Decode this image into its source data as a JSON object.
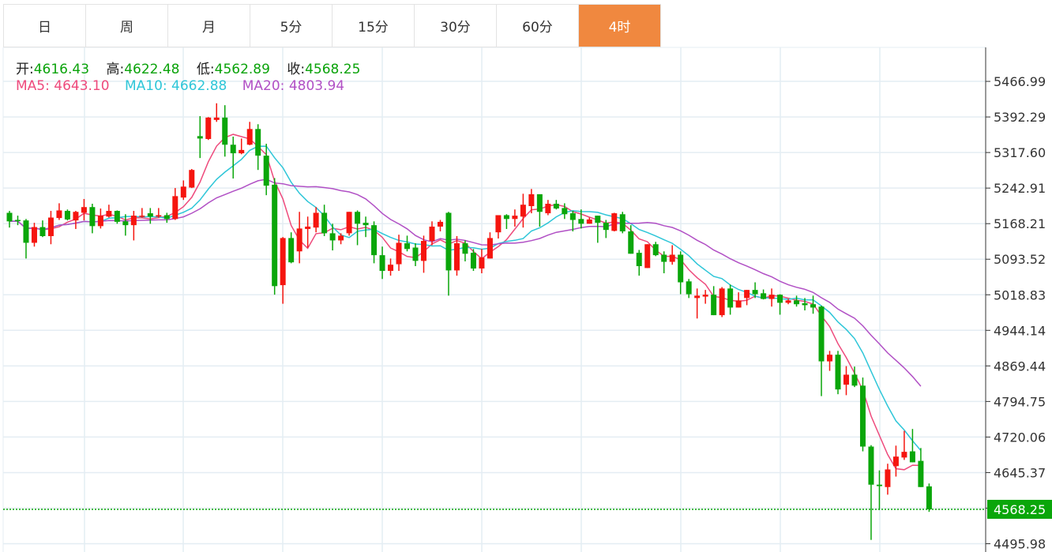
{
  "tabs": [
    {
      "label": "日",
      "active": false
    },
    {
      "label": "周",
      "active": false
    },
    {
      "label": "月",
      "active": false
    },
    {
      "label": "5分",
      "active": false
    },
    {
      "label": "15分",
      "active": false
    },
    {
      "label": "30分",
      "active": false
    },
    {
      "label": "60分",
      "active": false
    },
    {
      "label": "4时",
      "active": true
    }
  ],
  "info": {
    "open_label": "开:",
    "open": "4616.43",
    "high_label": "高:",
    "high": "4622.48",
    "low_label": "低:",
    "low": "4562.89",
    "close_label": "收:",
    "close": "4568.25",
    "ma5_label": "MA5:",
    "ma5": "4643.10",
    "ma10_label": "MA10:",
    "ma10": "4662.88",
    "ma20_label": "MA20:",
    "ma20": "4803.94"
  },
  "colors": {
    "up": "#f5150f",
    "down": "#0aa60a",
    "ma5": "#ee4a7c",
    "ma10": "#2ec6d8",
    "ma20": "#b150c5",
    "accent": "#f0883f",
    "grid": "#e4edf3"
  },
  "chart_data": {
    "type": "candlestick",
    "y_ticks": [
      "5466.99",
      "5392.29",
      "5317.60",
      "5242.91",
      "5168.21",
      "5093.52",
      "5018.83",
      "4944.14",
      "4869.44",
      "4794.75",
      "4720.06",
      "4645.37",
      "4570.68",
      "4495.98"
    ],
    "ylim": [
      4478.6,
      5538.4
    ],
    "last_price": "4568.25",
    "grid": true,
    "ohlc": [
      [
        5191,
        5195,
        5160,
        5173
      ],
      [
        5176,
        5185,
        5165,
        5174
      ],
      [
        5175,
        5178,
        5095,
        5128
      ],
      [
        5128,
        5170,
        5120,
        5161
      ],
      [
        5161,
        5175,
        5140,
        5142
      ],
      [
        5142,
        5195,
        5125,
        5181
      ],
      [
        5180,
        5211,
        5176,
        5196
      ],
      [
        5195,
        5198,
        5175,
        5177
      ],
      [
        5175,
        5195,
        5157,
        5193
      ],
      [
        5191,
        5220,
        5175,
        5203
      ],
      [
        5203,
        5210,
        5148,
        5163
      ],
      [
        5163,
        5200,
        5158,
        5185
      ],
      [
        5183,
        5208,
        5181,
        5195
      ],
      [
        5195,
        5196,
        5168,
        5172
      ],
      [
        5173,
        5188,
        5143,
        5165
      ],
      [
        5165,
        5195,
        5133,
        5185
      ],
      [
        5183,
        5201,
        5181,
        5185
      ],
      [
        5190,
        5201,
        5168,
        5183
      ],
      [
        5183,
        5201,
        5181,
        5186
      ],
      [
        5186,
        5191,
        5170,
        5178
      ],
      [
        5178,
        5243,
        5176,
        5226
      ],
      [
        5223,
        5259,
        5218,
        5246
      ],
      [
        5244,
        5283,
        5243,
        5281
      ],
      [
        5352,
        5394,
        5306,
        5347
      ],
      [
        5346,
        5392,
        5344,
        5391
      ],
      [
        5386,
        5421,
        5382,
        5391
      ],
      [
        5391,
        5417,
        5309,
        5334
      ],
      [
        5334,
        5351,
        5263,
        5316
      ],
      [
        5316,
        5347,
        5314,
        5323
      ],
      [
        5334,
        5382,
        5333,
        5367
      ],
      [
        5367,
        5377,
        5281,
        5311
      ],
      [
        5311,
        5336,
        5228,
        5248
      ],
      [
        5250,
        5264,
        5019,
        5037
      ],
      [
        5039,
        5140,
        5000,
        5138
      ],
      [
        5138,
        5150,
        5085,
        5087
      ],
      [
        5110,
        5193,
        5085,
        5158
      ],
      [
        5157,
        5183,
        5118,
        5162
      ],
      [
        5160,
        5203,
        5150,
        5191
      ],
      [
        5191,
        5208,
        5142,
        5148
      ],
      [
        5148,
        5168,
        5112,
        5133
      ],
      [
        5133,
        5148,
        5125,
        5143
      ],
      [
        5148,
        5193,
        5143,
        5193
      ],
      [
        5193,
        5196,
        5123,
        5168
      ],
      [
        5170,
        5183,
        5140,
        5165
      ],
      [
        5165,
        5173,
        5085,
        5102
      ],
      [
        5102,
        5120,
        5052,
        5069
      ],
      [
        5069,
        5095,
        5059,
        5082
      ],
      [
        5083,
        5145,
        5069,
        5128
      ],
      [
        5127,
        5143,
        5110,
        5115
      ],
      [
        5118,
        5127,
        5079,
        5090
      ],
      [
        5090,
        5143,
        5065,
        5132
      ],
      [
        5132,
        5173,
        5123,
        5162
      ],
      [
        5162,
        5176,
        5152,
        5172
      ],
      [
        5191,
        5193,
        5017,
        5070
      ],
      [
        5070,
        5142,
        5059,
        5127
      ],
      [
        5127,
        5133,
        5089,
        5105
      ],
      [
        5107,
        5115,
        5069,
        5074
      ],
      [
        5074,
        5115,
        5064,
        5097
      ],
      [
        5095,
        5150,
        5095,
        5138
      ],
      [
        5150,
        5186,
        5137,
        5186
      ],
      [
        5186,
        5188,
        5157,
        5178
      ],
      [
        5178,
        5198,
        5162,
        5185
      ],
      [
        5183,
        5231,
        5160,
        5208
      ],
      [
        5205,
        5241,
        5190,
        5230
      ],
      [
        5230,
        5230,
        5162,
        5193
      ],
      [
        5190,
        5218,
        5186,
        5210
      ],
      [
        5210,
        5218,
        5198,
        5200
      ],
      [
        5201,
        5211,
        5178,
        5188
      ],
      [
        5190,
        5195,
        5152,
        5176
      ],
      [
        5178,
        5198,
        5158,
        5168
      ],
      [
        5168,
        5181,
        5168,
        5177
      ],
      [
        5185,
        5185,
        5128,
        5170
      ],
      [
        5170,
        5176,
        5138,
        5155
      ],
      [
        5153,
        5191,
        5152,
        5190
      ],
      [
        5188,
        5193,
        5148,
        5152
      ],
      [
        5152,
        5165,
        5105,
        5105
      ],
      [
        5107,
        5113,
        5059,
        5079
      ],
      [
        5075,
        5125,
        5075,
        5125
      ],
      [
        5125,
        5130,
        5100,
        5102
      ],
      [
        5103,
        5110,
        5064,
        5088
      ],
      [
        5088,
        5123,
        5082,
        5103
      ],
      [
        5103,
        5110,
        5020,
        5045
      ],
      [
        5047,
        5052,
        5012,
        5020
      ],
      [
        5012,
        5032,
        4969,
        5017
      ],
      [
        5015,
        5029,
        5000,
        5019
      ],
      [
        5019,
        5037,
        4976,
        4976
      ],
      [
        4976,
        5035,
        4972,
        5032
      ],
      [
        5032,
        5040,
        4977,
        4992
      ],
      [
        4992,
        5024,
        4992,
        5007
      ],
      [
        5012,
        5029,
        4997,
        5029
      ],
      [
        5029,
        5045,
        5012,
        5020
      ],
      [
        5022,
        5030,
        5009,
        5010
      ],
      [
        5010,
        5032,
        4994,
        5019
      ],
      [
        5019,
        5020,
        4977,
        5002
      ],
      [
        5002,
        5010,
        4999,
        5007
      ],
      [
        5007,
        5017,
        4994,
        4999
      ],
      [
        5001,
        5012,
        4986,
        4997
      ],
      [
        4999,
        5017,
        4979,
        4992
      ],
      [
        4994,
        4996,
        4806,
        4879
      ],
      [
        4879,
        4901,
        4859,
        4893
      ],
      [
        4893,
        4901,
        4810,
        4820
      ],
      [
        4830,
        4869,
        4808,
        4851
      ],
      [
        4851,
        4868,
        4825,
        4828
      ],
      [
        4828,
        4845,
        4690,
        4700
      ],
      [
        4700,
        4703,
        4504,
        4620
      ],
      [
        4620,
        4650,
        4567,
        4617
      ],
      [
        4615,
        4664,
        4599,
        4652
      ],
      [
        4659,
        4702,
        4637,
        4679
      ],
      [
        4677,
        4733,
        4672,
        4689
      ],
      [
        4690,
        4737,
        4667,
        4667
      ],
      [
        4670,
        4697,
        4615,
        4615
      ],
      [
        4616.43,
        4622.48,
        4562.89,
        4568.25
      ]
    ]
  }
}
